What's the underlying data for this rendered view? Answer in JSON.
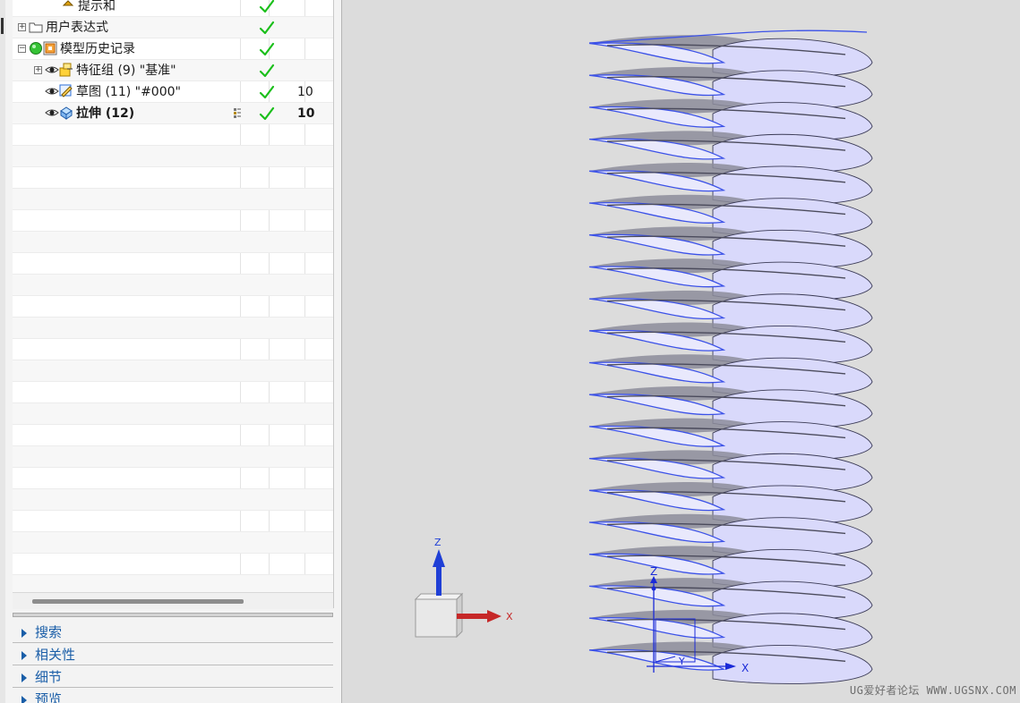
{
  "navigator": {
    "tree": [
      {
        "label": "提示和",
        "indent": 2,
        "expander": "",
        "icon": "partial",
        "check": true,
        "num": ""
      },
      {
        "label": "用户表达式",
        "indent": 0,
        "expander": "+",
        "icon": "folder-icon",
        "check": true,
        "num": ""
      },
      {
        "label": "模型历史记录",
        "indent": 0,
        "expander": "−",
        "icon": "history-icon",
        "check": true,
        "num": ""
      },
      {
        "label": "特征组 (9) \"基准\"",
        "indent": 1,
        "expander": "+",
        "icon": "feature-group-icon",
        "check": true,
        "num": ""
      },
      {
        "label": "草图 (11) \"#000\"",
        "indent": 1,
        "expander": "",
        "icon": "sketch-icon",
        "check": true,
        "num": "10"
      },
      {
        "label": "拉伸 (12)",
        "indent": 1,
        "expander": "",
        "icon": "extrude-icon",
        "check": true,
        "num": "10",
        "bold": true
      }
    ],
    "panels": [
      {
        "label": "搜索"
      },
      {
        "label": "相关性"
      },
      {
        "label": "细节"
      },
      {
        "label": "预览"
      }
    ]
  },
  "viewport": {
    "fin_count": 20,
    "colors": {
      "fin_fill": "#d9d9fb",
      "fin_edge": "#3c52e8",
      "shadow": "#8c8c9a",
      "background": "#dcdcdc"
    },
    "triad": {
      "z": "Z",
      "x": "X"
    },
    "csys": {
      "z": "Z",
      "x": "X",
      "y": "Y"
    },
    "watermark": "UG爱好者论坛 WWW.UGSNX.COM"
  }
}
